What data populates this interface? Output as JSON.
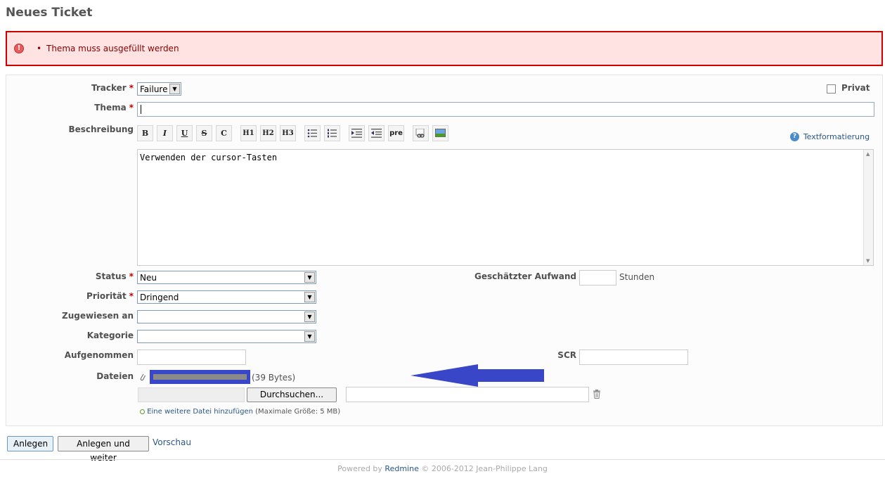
{
  "page": {
    "title": "Neues Ticket"
  },
  "flash": {
    "error_item": "Thema muss ausgefüllt werden"
  },
  "form": {
    "tracker_label": "Tracker",
    "tracker_value": "Failure",
    "private_label": "Privat",
    "subject_label": "Thema",
    "subject_value": "",
    "description_label": "Beschreibung",
    "description_value": "Verwenden der cursor-Tasten",
    "text_formatting_link": "Textformatierung",
    "toolbar": [
      "B",
      "I",
      "U",
      "S",
      "C",
      "H1",
      "H2",
      "H3",
      "ul",
      "ol",
      "indent-in",
      "indent-out",
      "pre",
      "link",
      "image"
    ],
    "status_label": "Status",
    "status_value": "Neu",
    "priority_label": "Priorität",
    "priority_value": "Dringend",
    "assigned_label": "Zugewiesen an",
    "assigned_value": "",
    "category_label": "Kategorie",
    "category_value": "",
    "estimated_label": "Geschätzter Aufwand",
    "estimated_value": "",
    "estimated_unit": "Stunden",
    "recorded_label": "Aufgenommen",
    "recorded_value": "",
    "scr_label": "SCR",
    "scr_value": "",
    "files_label": "Dateien",
    "file_size": "(39 Bytes)",
    "browse_button": "Durchsuchen...",
    "add_file_link": "Eine weitere Datei hinzufügen",
    "max_size": "(Maximale Größe: 5 MB)",
    "required_marker": "*"
  },
  "actions": {
    "create": "Anlegen",
    "create_continue": "Anlegen und weiter",
    "preview": "Vorschau"
  },
  "footer": {
    "powered_by": "Powered by",
    "redmine": "Redmine",
    "copyright": "© 2006-2012 Jean-Philippe Lang"
  },
  "colors": {
    "error_border": "#d00000",
    "error_bg": "#ffe3e3",
    "link": "#2a5685",
    "annotation_arrow": "#3a46c8"
  }
}
